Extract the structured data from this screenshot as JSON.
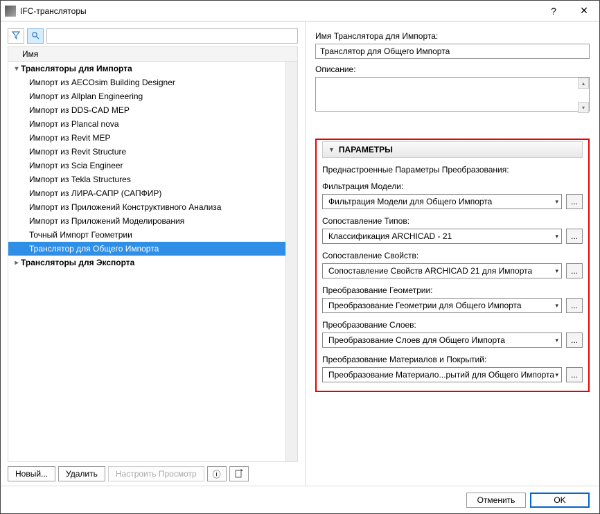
{
  "window": {
    "title": "IFC-трансляторы"
  },
  "left": {
    "header": "Имя",
    "groups": {
      "import": {
        "label": "Трансляторы для Импорта"
      },
      "export": {
        "label": "Трансляторы для Экспорта"
      }
    },
    "import_items": [
      "Импорт из AECOsim Building Designer",
      "Импорт из Allplan Engineering",
      "Импорт из DDS-CAD MEP",
      "Импорт из Plancal nova",
      "Импорт из Revit MEP",
      "Импорт из Revit Structure",
      "Импорт из Scia Engineer",
      "Импорт из Tekla Structures",
      "Импорт из ЛИРА-САПР (САПФИР)",
      "Импорт из Приложений Конструктивного Анализа",
      "Импорт из Приложений Моделирования",
      "Точный Импорт Геометрии",
      "Транслятор для Общего Импорта"
    ],
    "buttons": {
      "new": "Новый...",
      "delete": "Удалить",
      "configure": "Настроить Просмотр"
    }
  },
  "right": {
    "name_label": "Имя Транслятора для Импорта:",
    "name_value": "Транслятор для Общего Импорта",
    "desc_label": "Описание:",
    "desc_value": "",
    "params_title": "ПАРАМЕТРЫ",
    "preset_label": "Преднастроенные Параметры Преобразования:",
    "params": [
      {
        "label": "Фильтрация Модели:",
        "value": "Фильтрация Модели для Общего Импорта"
      },
      {
        "label": "Сопоставление Типов:",
        "value": "Классификация ARCHICAD - 21"
      },
      {
        "label": "Сопоставление Свойств:",
        "value": "Сопоставление Свойств ARCHICAD 21 для Импорта"
      },
      {
        "label": "Преобразование Геометрии:",
        "value": "Преобразование Геометрии для Общего Импорта"
      },
      {
        "label": "Преобразование Слоев:",
        "value": "Преобразование Слоев для Общего Импорта"
      },
      {
        "label": "Преобразование Материалов и Покрытий:",
        "value": "Преобразование Материало...рытий для Общего Импорта"
      }
    ]
  },
  "footer": {
    "cancel": "Отменить",
    "ok": "OK"
  },
  "icons": {
    "filter": "⛯",
    "search": "⌕",
    "info": "ⓘ",
    "share": "⎘"
  }
}
